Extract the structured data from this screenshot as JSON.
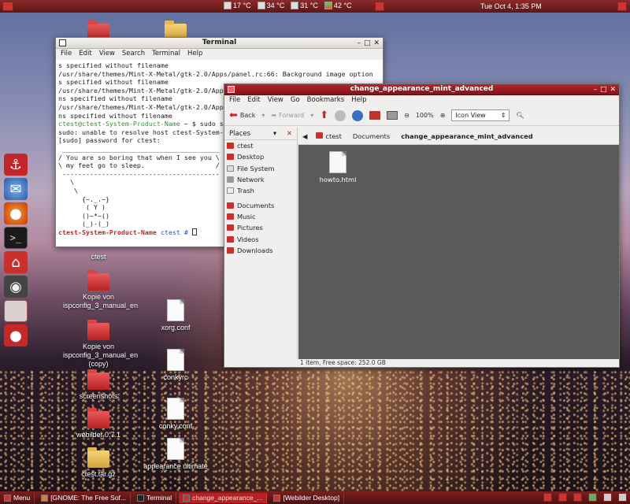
{
  "top_panel": {
    "temps": [
      {
        "value": "17 °C",
        "icon": "hdd-icon"
      },
      {
        "value": "34 °C",
        "icon": "hdd-icon"
      },
      {
        "value": "31 °C",
        "icon": "hdd-icon"
      },
      {
        "value": "42 °C",
        "icon": "cpu-icon"
      }
    ],
    "clock": "Tue Oct  4,  1:35 PM"
  },
  "desktop_icons": [
    {
      "label": "ctest",
      "type": "folder"
    },
    {
      "label": "Kopie von ispconfig_3_manual_en",
      "type": "folder"
    },
    {
      "label": "Kopie von ispconfig_3_manual_en (copy)",
      "type": "folder"
    },
    {
      "label": "screenshots",
      "type": "folder"
    },
    {
      "label": "webilder 0.7.1",
      "type": "folder"
    },
    {
      "label": "ctest.tar.gz",
      "type": "archive"
    },
    {
      "label": "xorg.conf",
      "type": "file"
    },
    {
      "label": "conkyrc",
      "type": "file"
    },
    {
      "label": "conky.conf",
      "type": "file"
    },
    {
      "label": "appearance ultimate",
      "type": "file"
    }
  ],
  "terminal": {
    "title": "Terminal",
    "menu": [
      "File",
      "Edit",
      "View",
      "Search",
      "Terminal",
      "Help"
    ],
    "lines": [
      "s specified without filename",
      "/usr/share/themes/Mint-X-Metal/gtk-2.0/Apps/panel.rc:66: Background image option",
      "s specified without filename",
      "/usr/share/themes/Mint-X-Metal/gtk-2.0/Apps/panel.rc:123: Background image option",
      "ns specified without filename",
      "/usr/share/themes/Mint-X-Metal/gtk-2.0/Apps/panel.rc:130: Background image option",
      "ns specified without filename"
    ],
    "prompt1_user": "ctest@ctest-System-Product-Name",
    "prompt1_rest": " ~ $ sudo su",
    "after_lines": [
      "sudo: unable to resolve host ctest-System-Product-Name",
      "[sudo] password for ctest:",
      " ________________________________________",
      "/ You are so boring that when I see you \\",
      "\\ my feet go to sleep.                  /",
      " ----------------------------------------",
      "   \\",
      "    \\",
      "",
      "      {~._.~}",
      "       ( Y )",
      "      ()~*~()",
      "      (_)-(_)"
    ],
    "prompt2_host": "ctest-System-Product-Name",
    "prompt2_dir": " ctest # "
  },
  "file_manager": {
    "title": "change_appearance_mint_advanced",
    "menu": [
      "File",
      "Edit",
      "View",
      "Go",
      "Bookmarks",
      "Help"
    ],
    "toolbar": {
      "back": "Back",
      "forward": "Forward",
      "zoom": "100%",
      "view_mode": "Icon View"
    },
    "places_header": "Places",
    "places": [
      "ctest",
      "Desktop",
      "File System",
      "Network",
      "Trash"
    ],
    "bookmarks": [
      "Documents",
      "Music",
      "Pictures",
      "Videos",
      "Downloads"
    ],
    "path": [
      "ctest",
      "Documents",
      "change_appearance_mint_advanced"
    ],
    "files": [
      {
        "name": "howto.html"
      }
    ],
    "status": "1 item, Free space: 252.0 GB"
  },
  "bottom_panel": {
    "menu_label": "Menu",
    "tasks": [
      {
        "label": "[GNOME: The Free Sof...",
        "active": false
      },
      {
        "label": "Terminal",
        "active": false
      },
      {
        "label": "change_appearance_...",
        "active": true
      },
      {
        "label": "[Webilder Desktop]",
        "active": false
      }
    ]
  }
}
